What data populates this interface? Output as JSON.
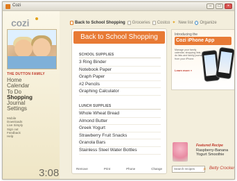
{
  "window": {
    "title": "Cozi",
    "buttons": {
      "minimize": "–",
      "maximize": "□",
      "close": "×"
    }
  },
  "sidebar": {
    "logo": "cozi",
    "family_name": "THE DUTTON FAMILY",
    "nav": [
      {
        "label": "Home",
        "active": false
      },
      {
        "label": "Calendar",
        "active": false
      },
      {
        "label": "To Do",
        "active": false
      },
      {
        "label": "Shopping",
        "active": true
      },
      {
        "label": "Journal",
        "active": false
      },
      {
        "label": "Settings",
        "active": false
      }
    ],
    "links": [
      "Mobile",
      "Downloads",
      "Live Simply",
      "Sign out",
      "Feedback",
      "Help"
    ],
    "clock": "3:08"
  },
  "tabs": [
    {
      "label": "Back to School Shopping",
      "icon": "list-icon",
      "active": true
    },
    {
      "label": "Groceries",
      "icon": "list-icon",
      "active": false
    },
    {
      "label": "Costco",
      "icon": "list-icon",
      "active": false
    },
    {
      "label": "New list",
      "icon": "star-icon",
      "active": false
    },
    {
      "label": "Organize",
      "icon": "organize-icon",
      "active": false
    }
  ],
  "list": {
    "title": "Back to School Shopping",
    "sections": [
      {
        "name": "SCHOOL SUPPLIES",
        "items": [
          "3 Ring Binder",
          "Notebook Paper",
          "Graph Paper",
          "#2 Pencils",
          "Graphing Calculator"
        ]
      },
      {
        "name": "LUNCH SUPPLIES",
        "items": [
          "Whole Wheat Bread",
          "Almond Butter",
          "Greek Yogurt",
          "Strawberry Fruit Snacks",
          "Granola Bars",
          "Stainless Steel Water Bottles"
        ]
      }
    ],
    "footer": [
      "Remove",
      "Print",
      "Phone",
      "Change"
    ]
  },
  "ad": {
    "small": "Introducing the",
    "title": "Cozi iPhone App",
    "body": "Manage your family calendar, shopping lists, to do lists and family journal from your iPhone.",
    "link": "Learn more »"
  },
  "recipe": {
    "heading": "Featured Recipe",
    "name": "Raspberry-Banana Yogurt Smoothie"
  },
  "search": {
    "placeholder": "Search recipes",
    "sponsor": "Betty Crocker"
  },
  "colors": {
    "accent": "#e87a35",
    "sidebar_bg": "#f3eedc",
    "family_name": "#c0392b"
  }
}
